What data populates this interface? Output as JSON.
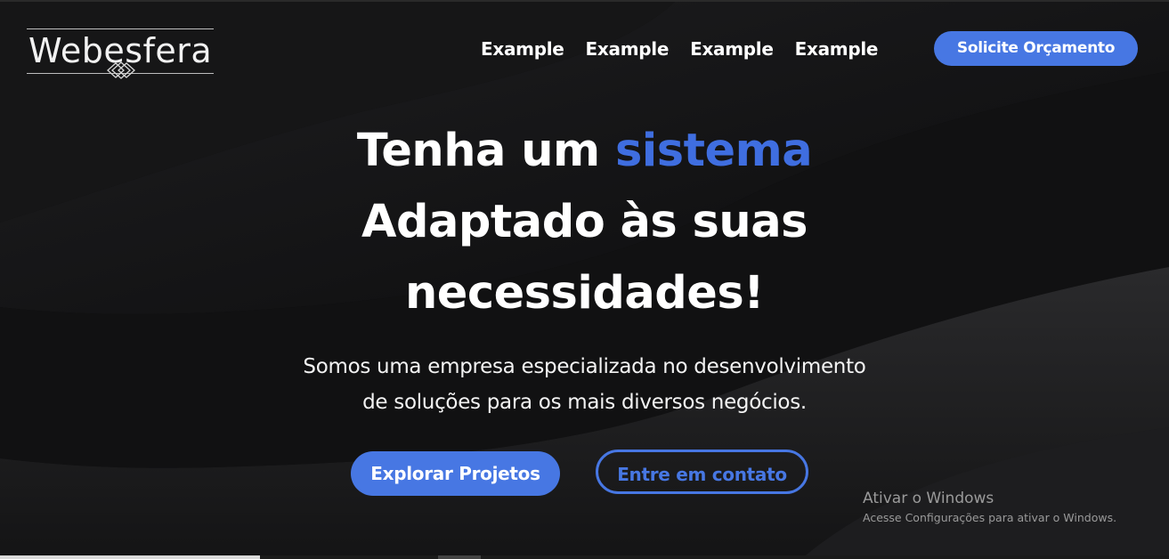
{
  "header": {
    "logo_text": "Webesfera",
    "nav": [
      {
        "label": "Example"
      },
      {
        "label": "Example"
      },
      {
        "label": "Example"
      },
      {
        "label": "Example"
      }
    ],
    "cta_label": "Solicite Orçamento"
  },
  "hero": {
    "headline_part1": "Tenha um",
    "headline_accent": "sistema",
    "headline_line2": "Adaptado às suas",
    "headline_line3": "necessidades!",
    "subtitle_line1": "Somos uma empresa especializada no desenvolvimento",
    "subtitle_line2": "de soluções para os mais diversos negócios.",
    "primary_button": "Explorar Projetos",
    "secondary_button": "Entre em contato"
  },
  "watermark": {
    "title": "Ativar o Windows",
    "subtitle": "Acesse Configurações para ativar o Windows."
  },
  "colors": {
    "background": "#0b0b0c",
    "accent": "#4777e3",
    "accent_text": "#3f6ee0",
    "text": "#ffffff"
  }
}
